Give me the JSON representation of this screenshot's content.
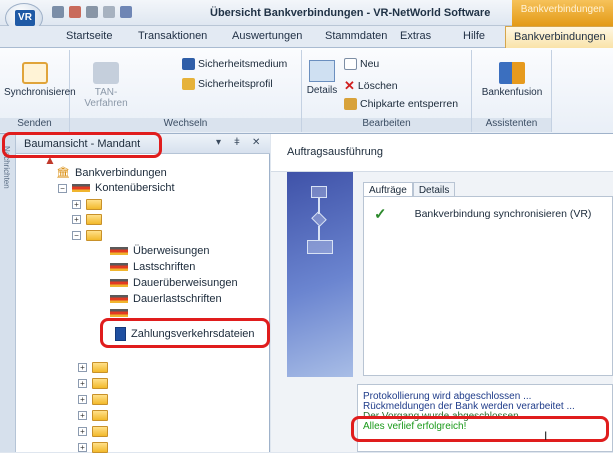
{
  "window": {
    "title": "Übersicht Bankverbindungen - VR-NetWorld Software",
    "contextual_tab": "Bankverbindungen"
  },
  "ribbon_tabs": [
    "Startseite",
    "Transaktionen",
    "Auswertungen",
    "Stammdaten",
    "Extras",
    "Hilfe",
    "Bankverbindungen"
  ],
  "ribbon": {
    "senden": {
      "label": "Senden",
      "synchronisieren": "Synchronisieren"
    },
    "wechseln": {
      "label": "Wechseln",
      "tan_verfahren": "TAN-Verfahren",
      "sicherheitsmedium": "Sicherheitsmedium",
      "sicherheitsprofil": "Sicherheitsprofil"
    },
    "bearbeiten": {
      "label": "Bearbeiten",
      "details": "Details",
      "neu": "Neu",
      "loeschen": "Löschen",
      "chipkarte": "Chipkarte entsperren"
    },
    "assistenten": {
      "label": "Assistenten",
      "bankenfusion": "Bankenfusion"
    }
  },
  "left_pane": {
    "side_tab": "Nachrichten",
    "title": "Baumansicht - Mandant",
    "controls": [
      "▾",
      "ǂ",
      "✕"
    ],
    "tree": {
      "bankverbindungen": "Bankverbindungen",
      "kontenuebersicht": "Kontenübersicht",
      "ueberweisungen": "Überweisungen",
      "lastschriften": "Lastschriften",
      "dauerueberweisungen": "Dauerüberweisungen",
      "dauerlastschriften": "Dauerlastschriften",
      "zahlungsverkehrsdateien": "Zahlungsverkehrsdateien"
    }
  },
  "right_pane": {
    "title": "Auftragsausführung",
    "tabs": [
      "Aufträge",
      "Details"
    ],
    "jobs": [
      {
        "status": "✓",
        "text": "Bankverbindung synchronisieren (VR)"
      }
    ],
    "log": [
      "Protokollierung wird abgeschlossen ...",
      "Rückmeldungen der Bank werden verarbeitet ...",
      "Der Vorgang wurde abgeschlossen.",
      "Alles verlief erfolgreich!"
    ]
  }
}
